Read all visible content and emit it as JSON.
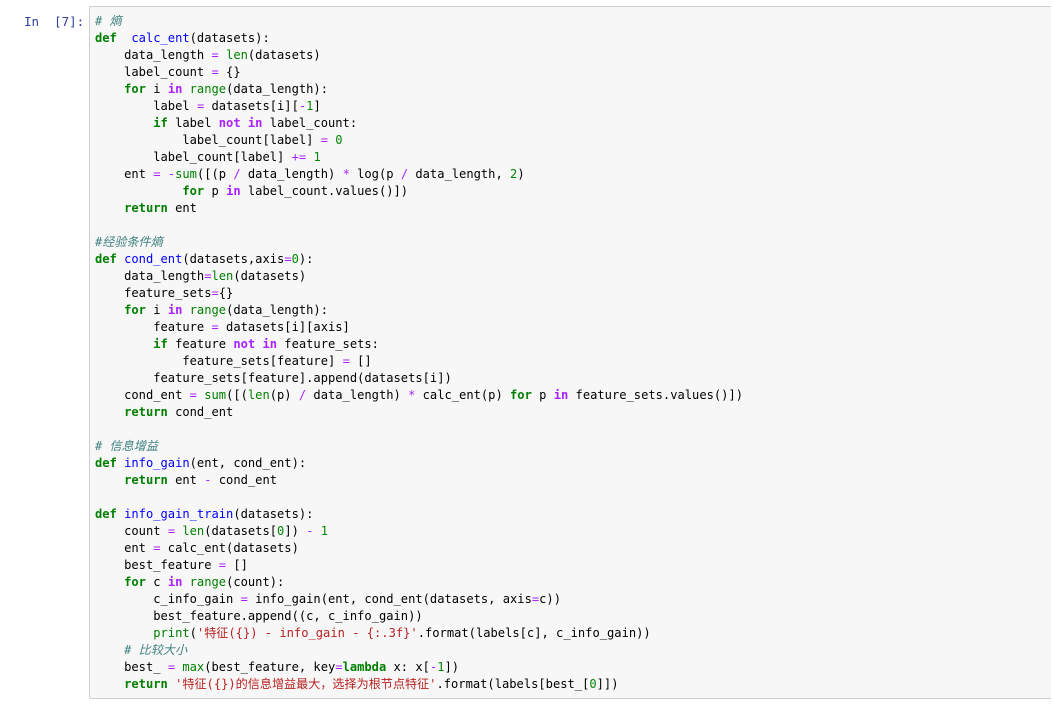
{
  "cell": {
    "prompt": "In  [7]:",
    "lines": [
      [
        [
          "cm",
          "# 熵"
        ]
      ],
      [
        [
          "kw",
          "def"
        ],
        [
          "",
          "  "
        ],
        [
          "fn",
          "calc_ent"
        ],
        [
          "",
          "(datasets):"
        ]
      ],
      [
        [
          "",
          "    data_length "
        ],
        [
          "op",
          "="
        ],
        [
          "",
          " "
        ],
        [
          "bi",
          "len"
        ],
        [
          "",
          "(datasets)"
        ]
      ],
      [
        [
          "",
          "    label_count "
        ],
        [
          "op",
          "="
        ],
        [
          "",
          " {}"
        ]
      ],
      [
        [
          "",
          "    "
        ],
        [
          "kw",
          "for"
        ],
        [
          "",
          " i "
        ],
        [
          "opw",
          "in"
        ],
        [
          "",
          " "
        ],
        [
          "bi",
          "range"
        ],
        [
          "",
          "(data_length):"
        ]
      ],
      [
        [
          "",
          "        label "
        ],
        [
          "op",
          "="
        ],
        [
          "",
          " datasets[i]["
        ],
        [
          "op",
          "-"
        ],
        [
          "num",
          "1"
        ],
        [
          "",
          "]"
        ]
      ],
      [
        [
          "",
          "        "
        ],
        [
          "kw",
          "if"
        ],
        [
          "",
          " label "
        ],
        [
          "opw",
          "not"
        ],
        [
          "",
          " "
        ],
        [
          "opw",
          "in"
        ],
        [
          "",
          " label_count:"
        ]
      ],
      [
        [
          "",
          "            label_count[label] "
        ],
        [
          "op",
          "="
        ],
        [
          "",
          " "
        ],
        [
          "num",
          "0"
        ]
      ],
      [
        [
          "",
          "        label_count[label] "
        ],
        [
          "op",
          "+="
        ],
        [
          "",
          " "
        ],
        [
          "num",
          "1"
        ]
      ],
      [
        [
          "",
          "    ent "
        ],
        [
          "op",
          "="
        ],
        [
          "",
          " "
        ],
        [
          "op",
          "-"
        ],
        [
          "bi",
          "sum"
        ],
        [
          "",
          "([(p "
        ],
        [
          "op",
          "/"
        ],
        [
          "",
          " data_length) "
        ],
        [
          "op",
          "*"
        ],
        [
          "",
          " log(p "
        ],
        [
          "op",
          "/"
        ],
        [
          "",
          " data_length, "
        ],
        [
          "num",
          "2"
        ],
        [
          "",
          ")"
        ]
      ],
      [
        [
          "",
          "            "
        ],
        [
          "kw",
          "for"
        ],
        [
          "",
          " p "
        ],
        [
          "opw",
          "in"
        ],
        [
          "",
          " label_count.values()])"
        ]
      ],
      [
        [
          "",
          "    "
        ],
        [
          "kw",
          "return"
        ],
        [
          "",
          " ent"
        ]
      ],
      [],
      [
        [
          "cm",
          "#经验条件熵"
        ]
      ],
      [
        [
          "kw",
          "def"
        ],
        [
          "",
          " "
        ],
        [
          "fn",
          "cond_ent"
        ],
        [
          "",
          "(datasets,axis"
        ],
        [
          "op",
          "="
        ],
        [
          "num",
          "0"
        ],
        [
          "",
          "):"
        ]
      ],
      [
        [
          "",
          "    data_length"
        ],
        [
          "op",
          "="
        ],
        [
          "bi",
          "len"
        ],
        [
          "",
          "(datasets)"
        ]
      ],
      [
        [
          "",
          "    feature_sets"
        ],
        [
          "op",
          "="
        ],
        [
          "",
          "{}"
        ]
      ],
      [
        [
          "",
          "    "
        ],
        [
          "kw",
          "for"
        ],
        [
          "",
          " i "
        ],
        [
          "opw",
          "in"
        ],
        [
          "",
          " "
        ],
        [
          "bi",
          "range"
        ],
        [
          "",
          "(data_length):"
        ]
      ],
      [
        [
          "",
          "        feature "
        ],
        [
          "op",
          "="
        ],
        [
          "",
          " datasets[i][axis]"
        ]
      ],
      [
        [
          "",
          "        "
        ],
        [
          "kw",
          "if"
        ],
        [
          "",
          " feature "
        ],
        [
          "opw",
          "not"
        ],
        [
          "",
          " "
        ],
        [
          "opw",
          "in"
        ],
        [
          "",
          " feature_sets:"
        ]
      ],
      [
        [
          "",
          "            feature_sets[feature] "
        ],
        [
          "op",
          "="
        ],
        [
          "",
          " []"
        ]
      ],
      [
        [
          "",
          "        feature_sets[feature].append(datasets[i])"
        ]
      ],
      [
        [
          "",
          "    cond_ent "
        ],
        [
          "op",
          "="
        ],
        [
          "",
          " "
        ],
        [
          "bi",
          "sum"
        ],
        [
          "",
          "([("
        ],
        [
          "bi",
          "len"
        ],
        [
          "",
          "(p) "
        ],
        [
          "op",
          "/"
        ],
        [
          "",
          " data_length) "
        ],
        [
          "op",
          "*"
        ],
        [
          "",
          " calc_ent(p) "
        ],
        [
          "kw",
          "for"
        ],
        [
          "",
          " p "
        ],
        [
          "opw",
          "in"
        ],
        [
          "",
          " feature_sets.values()])"
        ]
      ],
      [
        [
          "",
          "    "
        ],
        [
          "kw",
          "return"
        ],
        [
          "",
          " cond_ent"
        ]
      ],
      [],
      [
        [
          "cm",
          "# 信息增益"
        ]
      ],
      [
        [
          "kw",
          "def"
        ],
        [
          "",
          " "
        ],
        [
          "fn",
          "info_gain"
        ],
        [
          "",
          "(ent, cond_ent):"
        ]
      ],
      [
        [
          "",
          "    "
        ],
        [
          "kw",
          "return"
        ],
        [
          "",
          " ent "
        ],
        [
          "op",
          "-"
        ],
        [
          "",
          " cond_ent"
        ]
      ],
      [],
      [
        [
          "kw",
          "def"
        ],
        [
          "",
          " "
        ],
        [
          "fn",
          "info_gain_train"
        ],
        [
          "",
          "(datasets):"
        ]
      ],
      [
        [
          "",
          "    count "
        ],
        [
          "op",
          "="
        ],
        [
          "",
          " "
        ],
        [
          "bi",
          "len"
        ],
        [
          "",
          "(datasets["
        ],
        [
          "num",
          "0"
        ],
        [
          "",
          "]) "
        ],
        [
          "op",
          "-"
        ],
        [
          "",
          " "
        ],
        [
          "num",
          "1"
        ]
      ],
      [
        [
          "",
          "    ent "
        ],
        [
          "op",
          "="
        ],
        [
          "",
          " calc_ent(datasets)"
        ]
      ],
      [
        [
          "",
          "    best_feature "
        ],
        [
          "op",
          "="
        ],
        [
          "",
          " []"
        ]
      ],
      [
        [
          "",
          "    "
        ],
        [
          "kw",
          "for"
        ],
        [
          "",
          " c "
        ],
        [
          "opw",
          "in"
        ],
        [
          "",
          " "
        ],
        [
          "bi",
          "range"
        ],
        [
          "",
          "(count):"
        ]
      ],
      [
        [
          "",
          "        c_info_gain "
        ],
        [
          "op",
          "="
        ],
        [
          "",
          " info_gain(ent, cond_ent(datasets, axis"
        ],
        [
          "op",
          "="
        ],
        [
          "",
          "c))"
        ]
      ],
      [
        [
          "",
          "        best_feature.append((c, c_info_gain))"
        ]
      ],
      [
        [
          "",
          "        "
        ],
        [
          "bi",
          "print"
        ],
        [
          "",
          "("
        ],
        [
          "str",
          "'特征({}) - info_gain - {:.3f}'"
        ],
        [
          "",
          ".format(labels[c], c_info_gain))"
        ]
      ],
      [
        [
          "",
          "    "
        ],
        [
          "cm",
          "# 比较大小"
        ]
      ],
      [
        [
          "",
          "    best_ "
        ],
        [
          "op",
          "="
        ],
        [
          "",
          " "
        ],
        [
          "bi",
          "max"
        ],
        [
          "",
          "(best_feature, key"
        ],
        [
          "op",
          "="
        ],
        [
          "kw",
          "lambda"
        ],
        [
          "",
          " x: x["
        ],
        [
          "op",
          "-"
        ],
        [
          "num",
          "1"
        ],
        [
          "",
          "])"
        ]
      ],
      [
        [
          "",
          "    "
        ],
        [
          "kw",
          "return"
        ],
        [
          "",
          " "
        ],
        [
          "str",
          "'特征({})的信息增益最大，选择为根节点特征'"
        ],
        [
          "",
          ".format(labels[best_["
        ],
        [
          "num",
          "0"
        ],
        [
          "",
          "]])"
        ]
      ]
    ]
  }
}
